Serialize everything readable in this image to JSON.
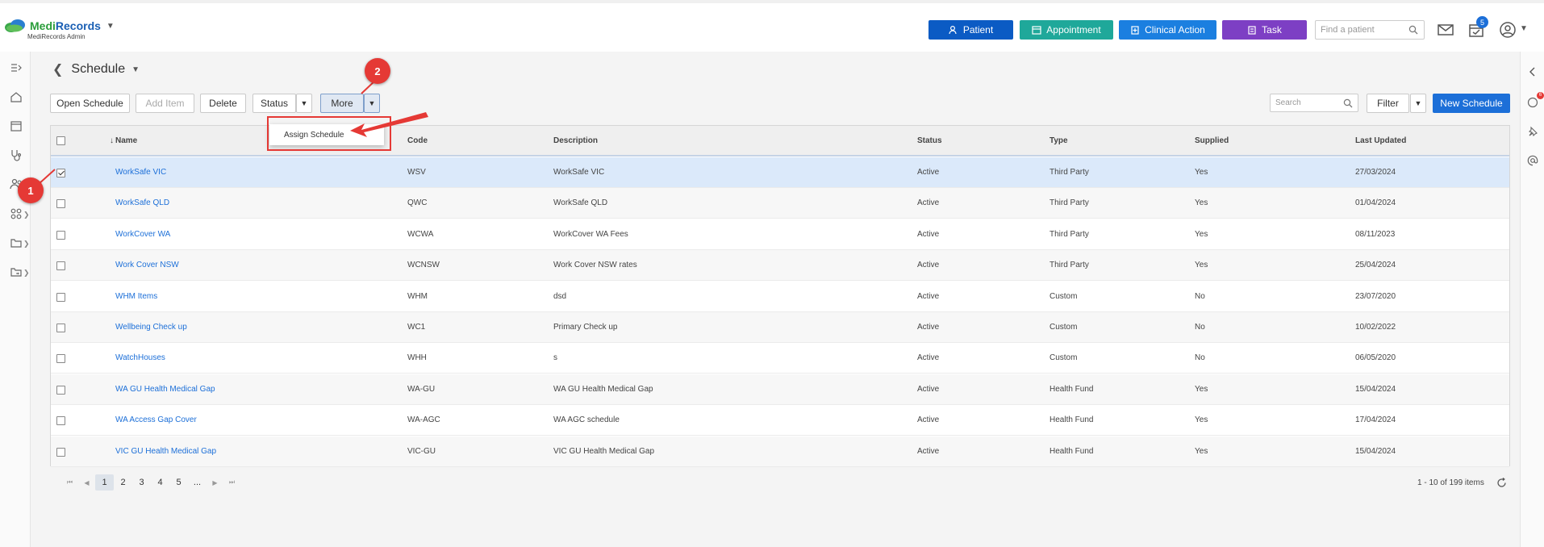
{
  "app": {
    "brand_a": "Medi",
    "brand_b": "Records",
    "subtitle": "MediRecords Admin"
  },
  "topbar": {
    "patient_label": "Patient",
    "appointment_label": "Appointment",
    "clinical_action_label": "Clinical Action",
    "task_label": "Task",
    "find_placeholder": "Find a patient",
    "task_badge": "5",
    "colors": {
      "patient": "#0b5bc4",
      "appointment": "#1fa89a",
      "clinical_action": "#1b7fe0",
      "task": "#7d3fc4"
    }
  },
  "page": {
    "title": "Schedule",
    "right_badge": "6"
  },
  "toolbar": {
    "open_schedule": "Open Schedule",
    "add_item": "Add Item",
    "delete": "Delete",
    "status": "Status",
    "more": "More",
    "search_placeholder": "Search",
    "filter": "Filter",
    "new_schedule": "New Schedule"
  },
  "more_menu": {
    "items": [
      "Assign Schedule"
    ]
  },
  "table": {
    "columns": [
      "Name",
      "Code",
      "Description",
      "Status",
      "Type",
      "Supplied",
      "Last Updated"
    ],
    "rows": [
      {
        "name": "WorkSafe VIC",
        "code": "WSV",
        "description": "WorkSafe VIC",
        "status": "Active",
        "type": "Third Party",
        "supplied": "Yes",
        "updated": "27/03/2024",
        "selected": true
      },
      {
        "name": "WorkSafe QLD",
        "code": "QWC",
        "description": "WorkSafe QLD",
        "status": "Active",
        "type": "Third Party",
        "supplied": "Yes",
        "updated": "01/04/2024",
        "selected": false
      },
      {
        "name": "WorkCover WA",
        "code": "WCWA",
        "description": "WorkCover WA Fees",
        "status": "Active",
        "type": "Third Party",
        "supplied": "Yes",
        "updated": "08/11/2023",
        "selected": false
      },
      {
        "name": "Work Cover NSW",
        "code": "WCNSW",
        "description": "Work Cover NSW rates",
        "status": "Active",
        "type": "Third Party",
        "supplied": "Yes",
        "updated": "25/04/2024",
        "selected": false
      },
      {
        "name": "WHM Items",
        "code": "WHM",
        "description": "dsd",
        "status": "Active",
        "type": "Custom",
        "supplied": "No",
        "updated": "23/07/2020",
        "selected": false
      },
      {
        "name": "Wellbeing Check up",
        "code": "WC1",
        "description": "Primary Check up",
        "status": "Active",
        "type": "Custom",
        "supplied": "No",
        "updated": "10/02/2022",
        "selected": false
      },
      {
        "name": "WatchHouses",
        "code": "WHH",
        "description": "s",
        "status": "Active",
        "type": "Custom",
        "supplied": "No",
        "updated": "06/05/2020",
        "selected": false
      },
      {
        "name": "WA GU Health Medical Gap",
        "code": "WA-GU",
        "description": "WA GU Health Medical Gap",
        "status": "Active",
        "type": "Health Fund",
        "supplied": "Yes",
        "updated": "15/04/2024",
        "selected": false
      },
      {
        "name": "WA Access Gap Cover",
        "code": "WA-AGC",
        "description": "WA AGC schedule",
        "status": "Active",
        "type": "Health Fund",
        "supplied": "Yes",
        "updated": "17/04/2024",
        "selected": false
      },
      {
        "name": "VIC GU Health Medical Gap",
        "code": "VIC-GU",
        "description": "VIC GU Health Medical Gap",
        "status": "Active",
        "type": "Health Fund",
        "supplied": "Yes",
        "updated": "15/04/2024",
        "selected": false
      }
    ]
  },
  "pager": {
    "pages": [
      "1",
      "2",
      "3",
      "4",
      "5",
      "..."
    ],
    "current": "1",
    "summary": "1 - 10 of 199 items"
  },
  "annotations": {
    "callout_1": "1",
    "callout_2": "2",
    "color": "#e53935"
  }
}
